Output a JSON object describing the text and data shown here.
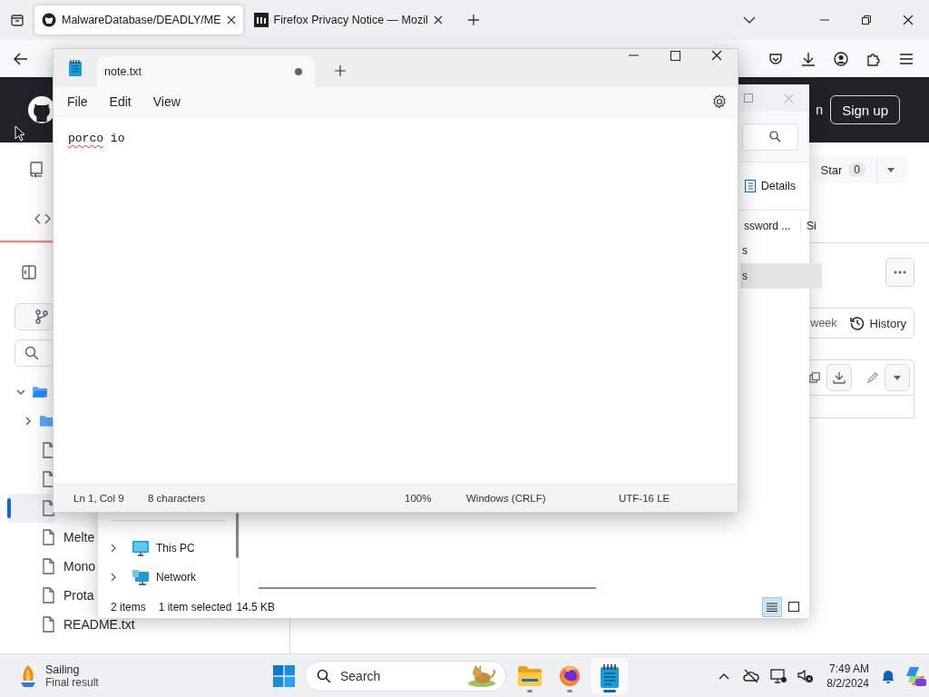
{
  "browser": {
    "tabs": [
      {
        "title": "MalwareDatabase/DEADLY/ME",
        "selected": true,
        "kind": "github"
      },
      {
        "title": "Firefox Privacy Notice — Mozil",
        "selected": false,
        "kind": "mozilla"
      }
    ]
  },
  "github": {
    "header_fragment": "n",
    "signup": "Sign up",
    "star": {
      "label": "Star",
      "count": "0"
    },
    "nav": [
      {
        "kind": "code",
        "selected": true
      }
    ],
    "tree": [
      {
        "kind": "folder",
        "expanded": true,
        "selected": false,
        "children": [
          {
            "kind": "folder",
            "expanded": false,
            "selected": false
          },
          {
            "kind": "file",
            "selected": false
          },
          {
            "kind": "file",
            "selected": false
          },
          {
            "kind": "file",
            "selected": true
          },
          {
            "kind": "file",
            "name": "Melte",
            "selected": false
          },
          {
            "kind": "file",
            "name": "Mono",
            "selected": false
          },
          {
            "kind": "file",
            "name": "Prota",
            "selected": false
          },
          {
            "kind": "file",
            "name": "README.txt",
            "selected": false
          }
        ]
      }
    ],
    "history": {
      "fragment": "week",
      "label": "History"
    }
  },
  "explorer": {
    "view_button": "Details",
    "columns": [
      "ssword ...",
      "Si"
    ],
    "rows": [
      {
        "name": "s",
        "selected": false
      },
      {
        "name": "s",
        "selected": true
      }
    ],
    "nav": [
      {
        "kind": "pc",
        "label": "This PC"
      },
      {
        "kind": "network",
        "label": "Network"
      }
    ],
    "status": {
      "count": "2 items",
      "selection": "1 item selected",
      "size": "14.5 KB"
    },
    "views": [
      {
        "kind": "details",
        "selected": true
      },
      {
        "kind": "tiles",
        "selected": false
      }
    ]
  },
  "notepad": {
    "tab": "note.txt",
    "modified": true,
    "menu": [
      "File",
      "Edit",
      "View"
    ],
    "words": [
      {
        "text": "porco",
        "misspelled": true
      },
      {
        "text": "io",
        "misspelled": false
      }
    ],
    "status": [
      "Ln 1, Col 9",
      "8 characters",
      "100%",
      "Windows (CRLF)",
      "UTF-16 LE"
    ]
  },
  "taskbar": {
    "widget": {
      "title": "Sailing",
      "subtitle": "Final result"
    },
    "search": {
      "placeholder": "Search"
    },
    "apps": [
      {
        "kind": "explorer",
        "running": true,
        "active": false
      },
      {
        "kind": "firefox",
        "running": true,
        "active": false
      },
      {
        "kind": "notepad",
        "running": true,
        "active": true
      }
    ],
    "time": "7:49 AM",
    "date": "8/2/2024"
  }
}
